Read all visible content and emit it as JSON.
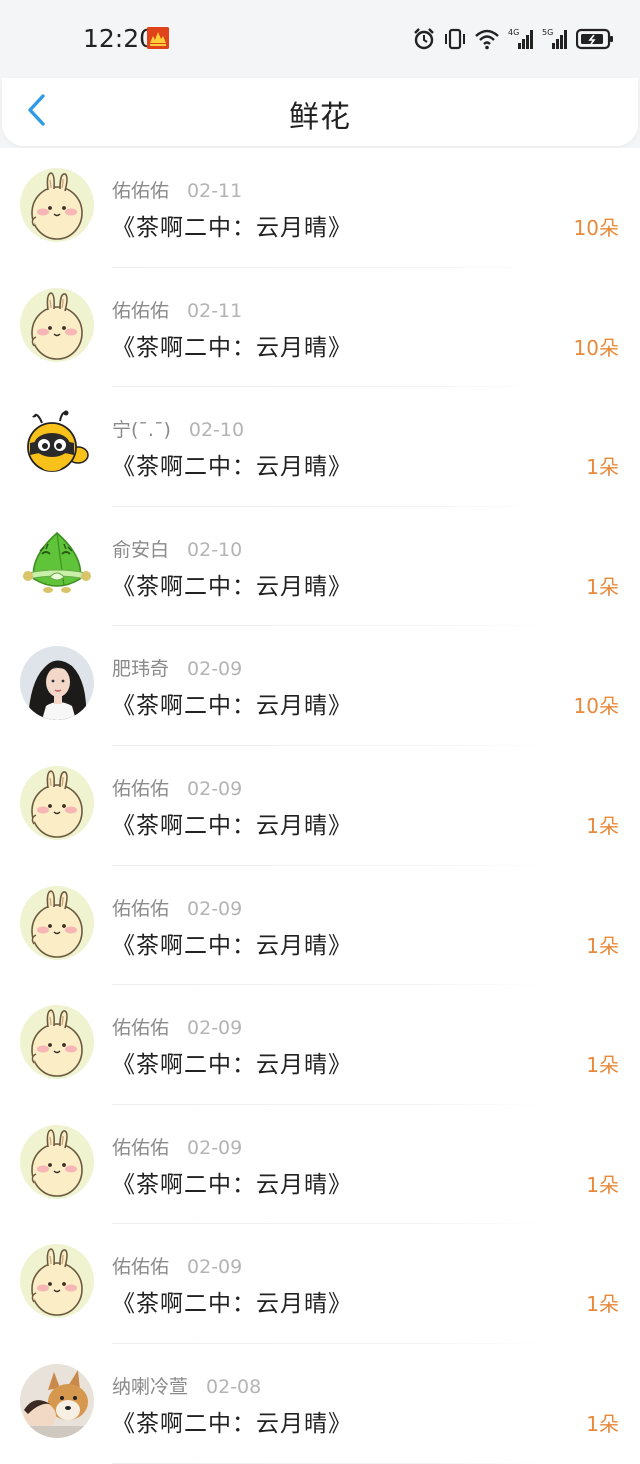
{
  "status_bar": {
    "time": "12:20",
    "icons": [
      "alarm-icon",
      "vibrate-icon",
      "wifi-icon",
      "signal-4g-icon",
      "signal-5g-icon",
      "battery-icon"
    ]
  },
  "header": {
    "title": "鲜花",
    "back_icon": "back-arrow-icon"
  },
  "colors": {
    "count": "#e8893b",
    "back": "#2f9be6",
    "meta": "#8a8a8a"
  },
  "rows": [
    {
      "avatar": "bunny",
      "user": "佑佑佑",
      "date": "02-11",
      "title": "《茶啊二中：云月晴》",
      "count": "10朵"
    },
    {
      "avatar": "bunny",
      "user": "佑佑佑",
      "date": "02-11",
      "title": "《茶啊二中：云月晴》",
      "count": "10朵"
    },
    {
      "avatar": "bee",
      "user": "宁(¯.¯)",
      "date": "02-10",
      "title": "《茶啊二中：云月晴》",
      "count": "1朵"
    },
    {
      "avatar": "zongzi",
      "user": "俞安白",
      "date": "02-10",
      "title": "《茶啊二中：云月晴》",
      "count": "1朵"
    },
    {
      "avatar": "girl",
      "user": "肥玮奇",
      "date": "02-09",
      "title": "《茶啊二中：云月晴》",
      "count": "10朵"
    },
    {
      "avatar": "bunny",
      "user": "佑佑佑",
      "date": "02-09",
      "title": "《茶啊二中：云月晴》",
      "count": "1朵"
    },
    {
      "avatar": "bunny",
      "user": "佑佑佑",
      "date": "02-09",
      "title": "《茶啊二中：云月晴》",
      "count": "1朵"
    },
    {
      "avatar": "bunny",
      "user": "佑佑佑",
      "date": "02-09",
      "title": "《茶啊二中：云月晴》",
      "count": "1朵"
    },
    {
      "avatar": "bunny",
      "user": "佑佑佑",
      "date": "02-09",
      "title": "《茶啊二中：云月晴》",
      "count": "1朵"
    },
    {
      "avatar": "bunny",
      "user": "佑佑佑",
      "date": "02-09",
      "title": "《茶啊二中：云月晴》",
      "count": "1朵"
    },
    {
      "avatar": "dog",
      "user": "纳喇冷萱",
      "date": "02-08",
      "title": "《茶啊二中：云月晴》",
      "count": "1朵"
    }
  ]
}
